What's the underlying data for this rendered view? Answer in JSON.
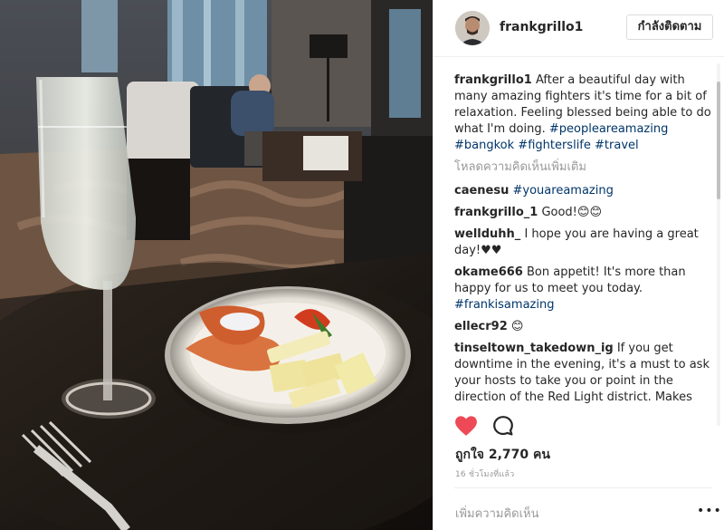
{
  "post": {
    "username": "frankgrillo1",
    "follow_label": "กำลังติดตาม",
    "caption": {
      "username": "frankgrillo1",
      "text": " After a beautiful day with many amazing fighters it's time for a bit of relaxation. Feeling blessed being able to do what I'm doing. ",
      "hashtags": [
        "#peopleareamazing",
        "#bangkok",
        "#fighterslife",
        "#travel"
      ]
    },
    "load_more_label": "โหลดความคิดเห็นเพิ่มเติม",
    "comments": [
      {
        "user": "caenesu",
        "text": "",
        "tag": "#youareamazing",
        "tail": ""
      },
      {
        "user": "frankgrillo_1",
        "text": " Good!",
        "tag": "",
        "tail": "😊😊"
      },
      {
        "user": "wellduhh_",
        "text": " I hope you are having a great day!",
        "tag": "",
        "tail": "♥♥"
      },
      {
        "user": "okame666",
        "text": " Bon appetit! It's more than happy for us to meet you today. ",
        "tag": "#frankisamazing",
        "tail": ""
      },
      {
        "user": "ellecr92",
        "text": " ",
        "tag": "",
        "tail": "😊"
      },
      {
        "user": "tinseltown_takedown_ig",
        "text": " If you get downtime in the evening, it's a must to ask your hosts to take you or point in the direction of the Red Light district. Makes",
        "tag": "",
        "tail": ""
      }
    ],
    "likes_label": "ถูกใจ 2,770 คน",
    "time_label": "16 ชั่วโมงที่แล้ว",
    "add_comment_placeholder": "เพิ่มความคิดเห็น",
    "more_label": "•••",
    "icons": {
      "like": "heart-icon",
      "comment": "comment-icon",
      "more": "more-options-icon"
    },
    "colors": {
      "heart": "#ed4956",
      "hashtag": "#003569",
      "muted": "#999999",
      "border": "#dbdbdb"
    }
  }
}
